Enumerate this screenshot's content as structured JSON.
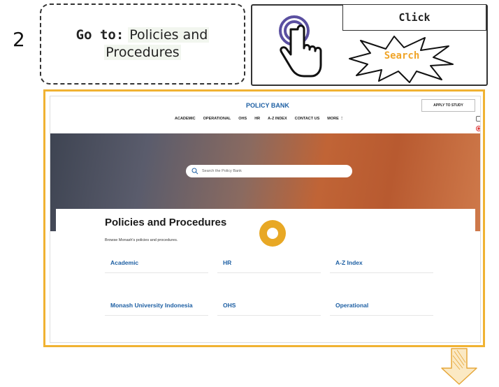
{
  "step": {
    "number": "2"
  },
  "instruction": {
    "prefix": "Go to:",
    "target_line1": "Policies and",
    "target_line2": "Procedures"
  },
  "action": {
    "click_label": "Click",
    "search_label": "Search"
  },
  "site": {
    "brand": "POLICY BANK",
    "apply_button": "APPLY TO STUDY",
    "nav": [
      "ACADEMIC",
      "OPERATIONAL",
      "OHS",
      "HR",
      "A-Z INDEX",
      "CONTACT US",
      "MORE ⋮"
    ],
    "search_placeholder": "Search the Policy Bank",
    "page_title": "Policies and Procedures",
    "page_subtitle": "Browse Monash's policies and procedures.",
    "links": [
      "Academic",
      "HR",
      "A-Z Index",
      "Monash University Indonesia",
      "OHS",
      "Operational"
    ]
  },
  "colors": {
    "accent": "#f0b232",
    "link": "#1d5fa3",
    "burst_text": "#f0a52a"
  },
  "icons": [
    "tap-hand-icon",
    "search-icon",
    "arrow-down-icon"
  ]
}
